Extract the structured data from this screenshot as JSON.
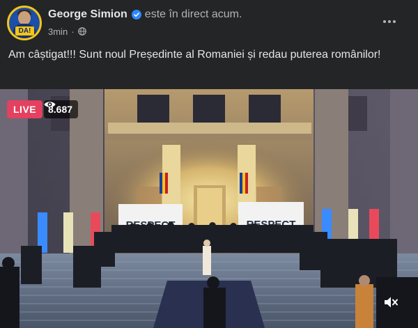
{
  "post": {
    "author": "George Simion",
    "status": "este în direct acum.",
    "time": "3min",
    "separator": "·",
    "caption": "Am câștigat!!! Sunt noul Președinte al Romaniei și redau puterea românilor!",
    "avatar_badge": "DA!"
  },
  "video": {
    "live_label": "LIVE",
    "viewer_count": "8.687",
    "banner_left": "RESPECT",
    "banner_right": "RESPECT"
  },
  "icons": {
    "verified": "verified-badge-icon",
    "privacy": "globe-icon",
    "more": "more-options-icon",
    "viewers": "eye-icon",
    "mute": "volume-muted-icon"
  },
  "colors": {
    "background": "#242526",
    "text_primary": "#e4e6eb",
    "text_secondary": "#b0b3b8",
    "verified": "#2d88ff",
    "live": "#e4405f"
  }
}
